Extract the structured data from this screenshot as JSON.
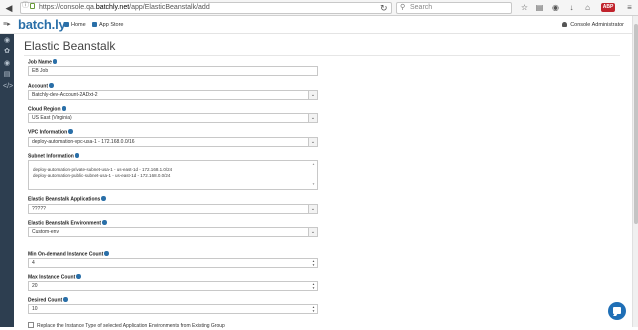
{
  "browser": {
    "url_prefix": "https://console.qa.",
    "url_host": "batchly.net",
    "url_path": "/app/ElasticBeanstalk/add",
    "search_placeholder": "Search"
  },
  "header": {
    "logo": "batch.ly",
    "links": [
      {
        "label": "Home",
        "icon": "home-icon"
      },
      {
        "label": "App Store",
        "icon": "store-icon"
      }
    ],
    "user": "Console Administrator"
  },
  "sidebar": {
    "icons": [
      "dashboard-icon",
      "wrench-icon",
      "binoculars-icon",
      "apps-icon",
      "code-icon"
    ]
  },
  "page": {
    "title": "Elastic Beanstalk"
  },
  "form": {
    "job_name": {
      "label": "Job Name",
      "value": "EB Job"
    },
    "account": {
      "label": "Account",
      "value": "Batchly-dev-Account-2ADxt-2"
    },
    "cloud_region": {
      "label": "Cloud Region",
      "value": "US East (Virginia)"
    },
    "vpc": {
      "label": "VPC Information",
      "value": "deploy-automation-vpc-usa-1 - 172.168.0.0/16"
    },
    "subnet": {
      "label": "Subnet Information",
      "options": [
        "deploy-automation-private-subnet-usa-1 - us-east-1d - 172.168.1.0/24",
        "deploy-automation-public-subnet-usa-1 - us-east-1d - 172.168.0.0/24"
      ]
    },
    "eb_application": {
      "label": "Elastic Beanstalk Applications",
      "value": "?????"
    },
    "eb_environment": {
      "label": "Elastic Beanstalk Environment",
      "value": "Custom-env"
    },
    "min_on_demand": {
      "label": "Min On-demand Instance Count",
      "value": "4"
    },
    "max_instance": {
      "label": "Max Instance Count",
      "value": "20"
    },
    "desired_count": {
      "label": "Desired Count",
      "value": "10"
    },
    "checkbox_label": "Replace the Instance Type of selected Application Environments from Existing Group"
  }
}
